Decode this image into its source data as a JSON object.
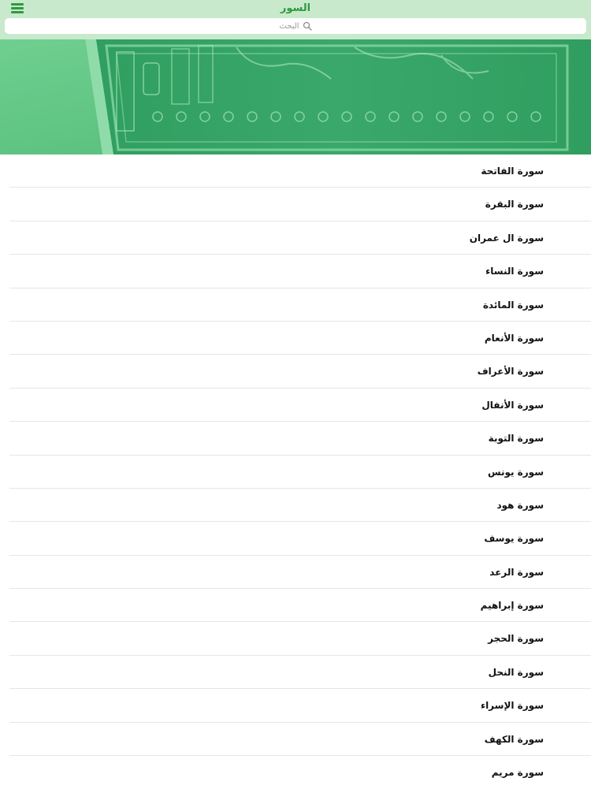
{
  "header": {
    "title": "السور",
    "menu_icon": "hamburger-menu-icon",
    "accent_color": "#2f9a3e"
  },
  "search": {
    "placeholder": "البحث",
    "icon": "search-icon"
  },
  "surahs": [
    {
      "label": "سورة الفاتحة"
    },
    {
      "label": "سورة البقرة"
    },
    {
      "label": "سورة ال عمران"
    },
    {
      "label": "سورة النساء"
    },
    {
      "label": "سورة المائدة"
    },
    {
      "label": "سورة الأنعام"
    },
    {
      "label": "سورة الأعراف"
    },
    {
      "label": "سورة الأنفال"
    },
    {
      "label": "سورة التوبة"
    },
    {
      "label": "سورة يونس"
    },
    {
      "label": "سورة هود"
    },
    {
      "label": "سورة يوسف"
    },
    {
      "label": "سورة الرعد"
    },
    {
      "label": "سورة إبراهيم"
    },
    {
      "label": "سورة الحجر"
    },
    {
      "label": "سورة النحل"
    },
    {
      "label": "سورة الإسراء"
    },
    {
      "label": "سورة الكهف"
    },
    {
      "label": "سورة مريم"
    }
  ]
}
